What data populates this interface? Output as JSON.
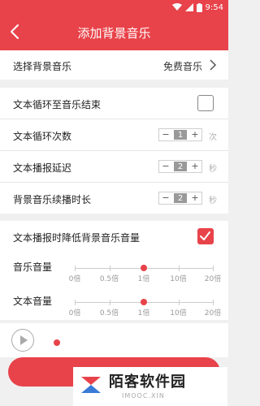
{
  "status_bar": {
    "time": "9:54"
  },
  "header": {
    "title": "添加背景音乐"
  },
  "music_select": {
    "label": "选择背景音乐",
    "value": "免费音乐"
  },
  "loop_to_end": {
    "label": "文本循环至音乐结束",
    "checked": false
  },
  "loop_count": {
    "label": "文本循环次数",
    "minus": "−",
    "plus": "+",
    "value": "1",
    "unit": "次"
  },
  "play_delay": {
    "label": "文本播报延迟",
    "minus": "−",
    "plus": "+",
    "value": "2",
    "unit": "秒"
  },
  "bg_continue": {
    "label": "背景音乐续播时长",
    "minus": "−",
    "plus": "+",
    "value": "2",
    "unit": "秒"
  },
  "lower_bg": {
    "label": "文本播报时降低背景音乐音量",
    "checked": true
  },
  "music_volume": {
    "label": "音乐音量",
    "ticks": [
      "0倍",
      "0.5倍",
      "1倍",
      "10倍",
      "20倍"
    ],
    "selected_index": 2
  },
  "text_volume": {
    "label": "文本音量",
    "ticks": [
      "0倍",
      "0.5倍",
      "1倍",
      "10倍",
      "20倍"
    ],
    "selected_index": 2
  },
  "colors": {
    "accent": "#e8434a"
  },
  "watermark": {
    "title": "陌客软件园",
    "sub": "IMOOC.XIN"
  }
}
